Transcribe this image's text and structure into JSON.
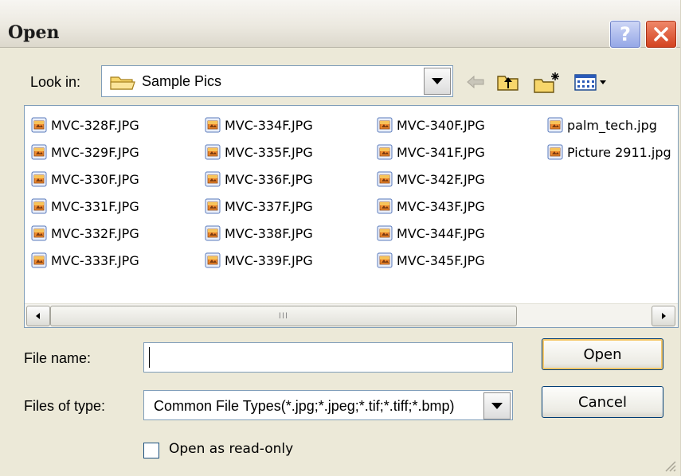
{
  "dialog": {
    "title": "Open",
    "help_symbol": "?",
    "icons": {
      "help": "question-icon",
      "close": "close-x-icon"
    }
  },
  "lookin": {
    "label": "Look in:",
    "value": "Sample Pics",
    "icons": {
      "folder": "folder-icon",
      "back": "back-arrow-icon",
      "up": "up-folder-icon",
      "new_folder": "new-folder-icon",
      "view_menu": "view-menu-icon"
    }
  },
  "files": [
    {
      "name": "MVC-328F.JPG"
    },
    {
      "name": "MVC-329F.JPG"
    },
    {
      "name": "MVC-330F.JPG"
    },
    {
      "name": "MVC-331F.JPG"
    },
    {
      "name": "MVC-332F.JPG"
    },
    {
      "name": "MVC-333F.JPG"
    },
    {
      "name": "MVC-334F.JPG"
    },
    {
      "name": "MVC-335F.JPG"
    },
    {
      "name": "MVC-336F.JPG"
    },
    {
      "name": "MVC-337F.JPG"
    },
    {
      "name": "MVC-338F.JPG"
    },
    {
      "name": "MVC-339F.JPG"
    },
    {
      "name": "MVC-340F.JPG"
    },
    {
      "name": "MVC-341F.JPG"
    },
    {
      "name": "MVC-342F.JPG"
    },
    {
      "name": "MVC-343F.JPG"
    },
    {
      "name": "MVC-344F.JPG"
    },
    {
      "name": "MVC-345F.JPG"
    },
    {
      "name": "palm_tech.jpg"
    },
    {
      "name": "Picture 2911.jpg"
    }
  ],
  "scrollbar": {
    "grip": "III"
  },
  "form": {
    "file_name_label": "File name:",
    "file_name_value": "",
    "files_of_type_label": "Files of type:",
    "files_of_type_value": "Common File Types(*.jpg;*.jpeg;*.tif;*.tiff;*.bmp)",
    "open_button": "Open",
    "cancel_button": "Cancel",
    "readonly_label": "Open as read-only",
    "readonly_checked": false
  },
  "colors": {
    "dialog_bg": "#ece9d8",
    "close_red": "#d2401e",
    "help_blue": "#93a6e6",
    "input_border": "#7f9db9",
    "default_button_glow": "#f6c86a"
  }
}
